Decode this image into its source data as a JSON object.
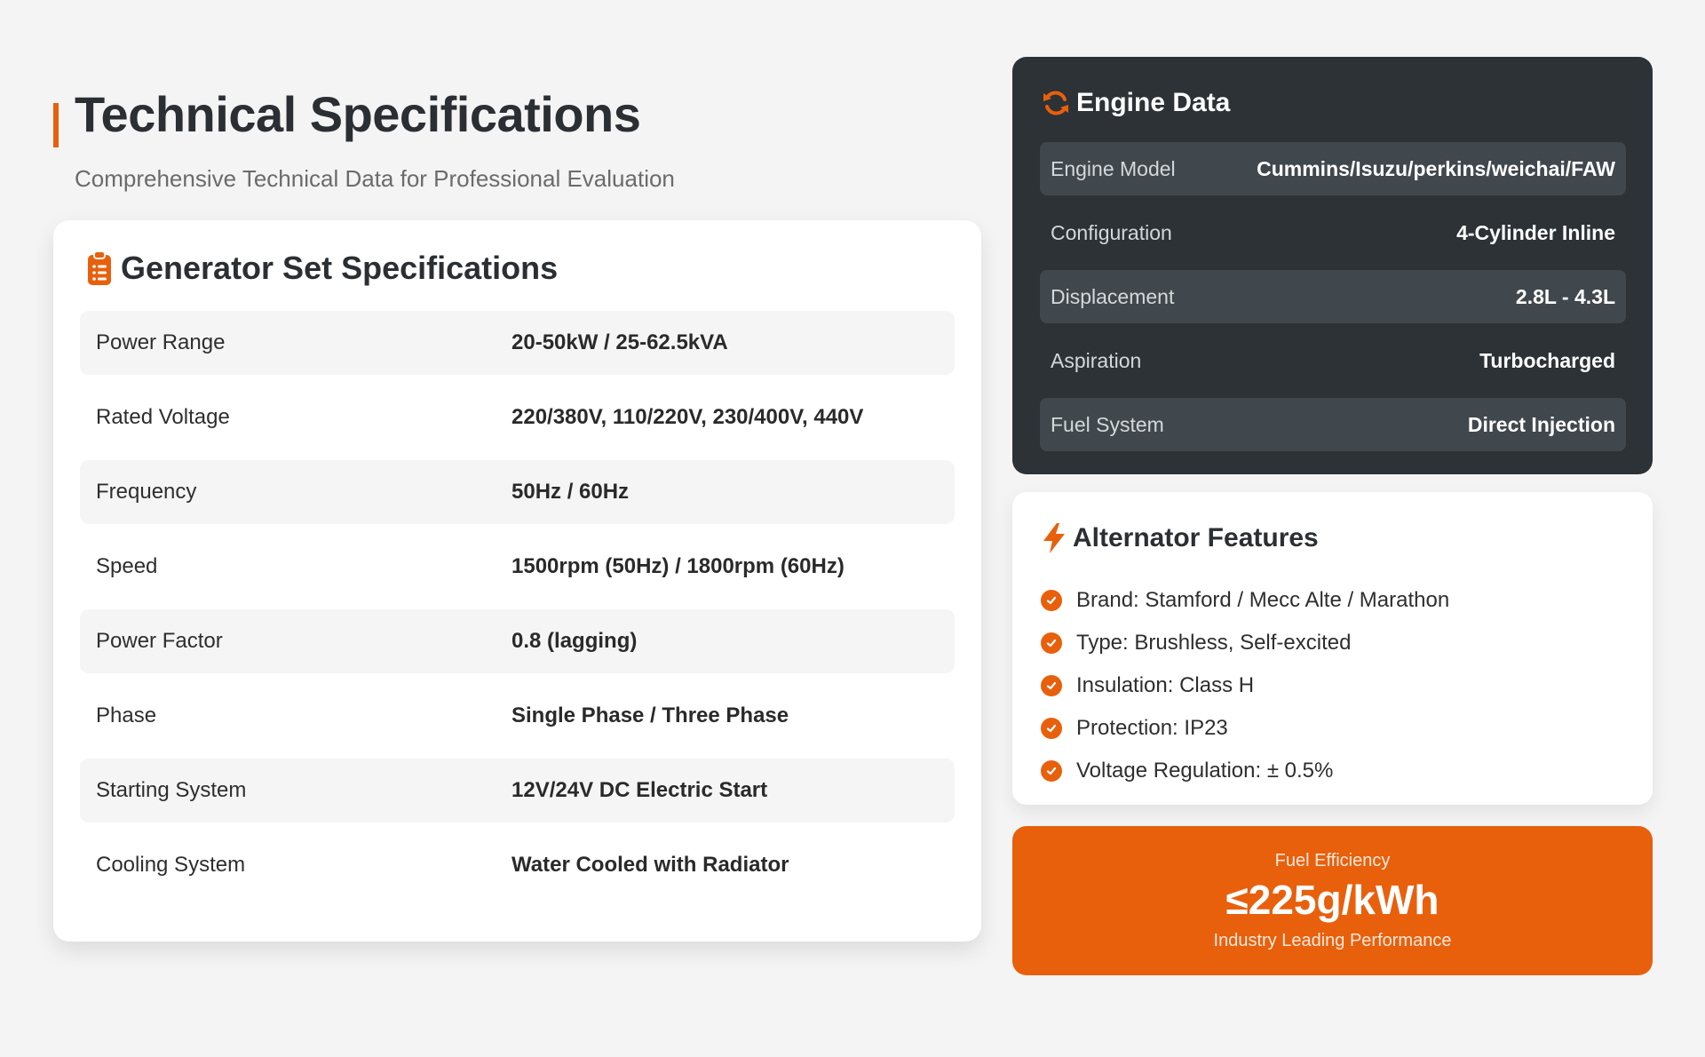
{
  "header": {
    "title": "Technical Specifications",
    "subtitle": "Comprehensive Technical Data for Professional Evaluation"
  },
  "generator": {
    "title": "Generator Set Specifications",
    "icon": "clipboard-list-icon",
    "rows": [
      {
        "label": "Power Range",
        "value": "20-50kW / 25-62.5kVA"
      },
      {
        "label": "Rated Voltage",
        "value": "220/380V, 110/220V, 230/400V, 440V"
      },
      {
        "label": "Frequency",
        "value": "50Hz / 60Hz"
      },
      {
        "label": "Speed",
        "value": "1500rpm (50Hz) / 1800rpm (60Hz)"
      },
      {
        "label": "Power Factor",
        "value": "0.8 (lagging)"
      },
      {
        "label": "Phase",
        "value": "Single Phase / Three Phase"
      },
      {
        "label": "Starting System",
        "value": "12V/24V DC Electric Start"
      },
      {
        "label": "Cooling System",
        "value": "Water Cooled with Radiator"
      }
    ]
  },
  "engine": {
    "title": "Engine Data",
    "icon": "sync-arrows-icon",
    "rows": [
      {
        "label": "Engine Model",
        "value": "Cummins/Isuzu/perkins/weichai/FAW"
      },
      {
        "label": "Configuration",
        "value": "4-Cylinder Inline"
      },
      {
        "label": "Displacement",
        "value": "2.8L - 4.3L"
      },
      {
        "label": "Aspiration",
        "value": "Turbocharged"
      },
      {
        "label": "Fuel System",
        "value": "Direct Injection"
      }
    ]
  },
  "alternator": {
    "title": "Alternator Features",
    "icon": "lightning-bolt-icon",
    "items": [
      "Brand: Stamford / Mecc Alte / Marathon",
      "Type: Brushless, Self-excited",
      "Insulation: Class H",
      "Protection: IP23",
      "Voltage Regulation: ± 0.5%"
    ]
  },
  "fuel": {
    "label": "Fuel Efficiency",
    "value": "≤225g/kWh",
    "subtitle": "Industry Leading Performance"
  },
  "colors": {
    "accent": "#e8600c",
    "dark_card": "#2c3236",
    "background": "#f4f4f4"
  }
}
